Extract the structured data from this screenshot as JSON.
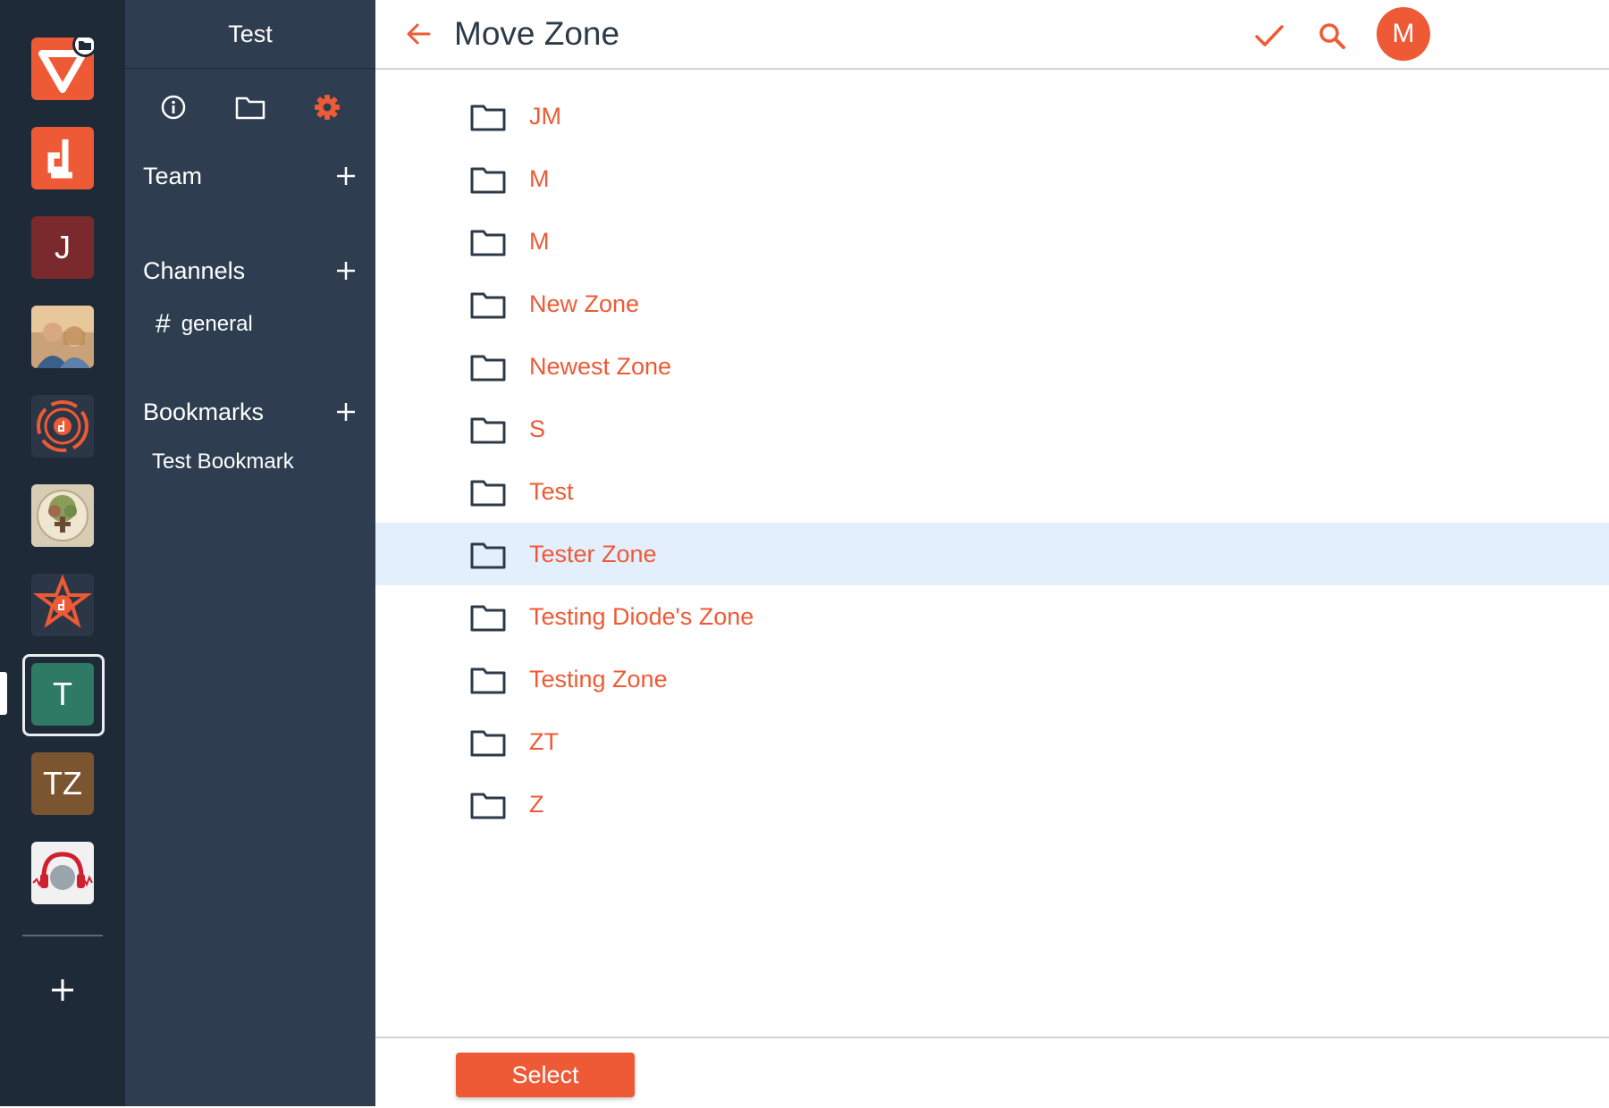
{
  "colors": {
    "accent": "#ee5a35",
    "rail_bg": "#1e2a38",
    "panel_bg": "#2e3e50",
    "selected_row_bg": "#e3effd",
    "title_text": "#2d3b48"
  },
  "rail": {
    "apps": [
      {
        "name": "app-logo-folder",
        "icon": "v-logo-folder-badge-icon",
        "bg": "#ee5a35"
      },
      {
        "name": "app-d-logo",
        "icon": "d-logo-icon",
        "bg": "#ee5a35"
      },
      {
        "name": "app-j",
        "letter": "J",
        "bg": "#7a2a2c"
      },
      {
        "name": "app-photo",
        "icon": "photo-avatar-icon",
        "bg": "#8a9bb0"
      },
      {
        "name": "app-orbit",
        "icon": "orbit-logo-icon",
        "bg": "#2b3646"
      },
      {
        "name": "app-tree",
        "icon": "tree-logo-icon",
        "bg": "#d8cdb4"
      },
      {
        "name": "app-star",
        "icon": "star-network-icon",
        "bg": "#2b3646"
      },
      {
        "name": "app-t",
        "letter": "T",
        "bg": "#2f7a64",
        "selected": true
      },
      {
        "name": "app-tz",
        "letter": "TZ",
        "bg": "#7b5430"
      },
      {
        "name": "app-headphones",
        "icon": "headphones-globe-icon",
        "bg": "#f1f1f1"
      }
    ],
    "add_icon": "plus-icon"
  },
  "panel": {
    "title": "Test",
    "tabs": [
      {
        "name": "info",
        "icon": "info-icon"
      },
      {
        "name": "folder",
        "icon": "folder-icon"
      },
      {
        "name": "settings",
        "icon": "gear-icon",
        "active": true
      }
    ],
    "team_label": "Team",
    "channels_label": "Channels",
    "channels": [
      {
        "hash": "#",
        "name": "general"
      }
    ],
    "bookmarks_label": "Bookmarks",
    "bookmarks": [
      "Test Bookmark"
    ]
  },
  "header": {
    "title": "Move Zone",
    "avatar_letter": "M"
  },
  "zones": [
    {
      "name": "JM"
    },
    {
      "name": "M"
    },
    {
      "name": "M"
    },
    {
      "name": "New Zone"
    },
    {
      "name": "Newest Zone"
    },
    {
      "name": "S"
    },
    {
      "name": "Test"
    },
    {
      "name": "Tester Zone",
      "selected": true
    },
    {
      "name": "Testing Diode's Zone"
    },
    {
      "name": "Testing Zone"
    },
    {
      "name": "ZT"
    },
    {
      "name": "Z"
    }
  ],
  "footer": {
    "select_label": "Select"
  }
}
